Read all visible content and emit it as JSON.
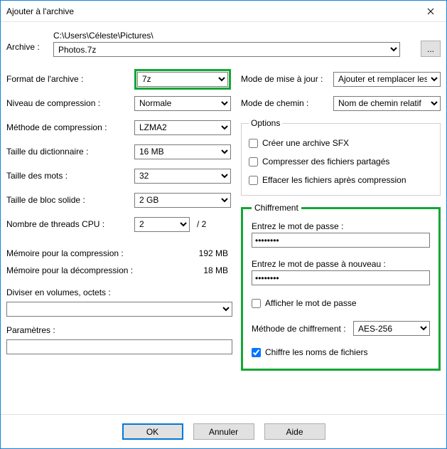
{
  "window": {
    "title": "Ajouter à l'archive"
  },
  "archive": {
    "label": "Archive :",
    "path": "C:\\Users\\Céleste\\Pictures\\",
    "file": "Photos.7z",
    "browse": "..."
  },
  "left": {
    "format_label": "Format de l'archive :",
    "format_value": "7z",
    "level_label": "Niveau de compression :",
    "level_value": "Normale",
    "method_label": "Méthode de compression :",
    "method_value": "LZMA2",
    "dict_label": "Taille du dictionnaire :",
    "dict_value": "16 MB",
    "word_label": "Taille des mots :",
    "word_value": "32",
    "block_label": "Taille de bloc solide :",
    "block_value": "2 GB",
    "threads_label": "Nombre de threads CPU :",
    "threads_value": "2",
    "threads_max": "/ 2",
    "mem_comp_label": "Mémoire pour la compression :",
    "mem_comp_value": "192 MB",
    "mem_decomp_label": "Mémoire pour la décompression :",
    "mem_decomp_value": "18 MB",
    "volumes_label": "Diviser en volumes, octets :",
    "volumes_value": "",
    "params_label": "Paramètres :",
    "params_value": ""
  },
  "right": {
    "update_label": "Mode de mise à jour :",
    "update_value": "Ajouter et remplacer les fichiers",
    "path_label": "Mode de chemin :",
    "path_value": "Nom de chemin relatif",
    "options_legend": "Options",
    "opt_sfx": "Créer une archive SFX",
    "opt_shared": "Compresser des fichiers partagés",
    "opt_delete": "Effacer les fichiers après compression"
  },
  "enc": {
    "legend": "Chiffrement",
    "pass1_label": "Entrez le mot de passe :",
    "pass1_value": "password",
    "pass2_label": "Entrez le mot de passe à nouveau :",
    "pass2_value": "password",
    "show_label": "Afficher le mot de passe",
    "method_label": "Méthode de chiffrement :",
    "method_value": "AES-256",
    "names_label": "Chiffre les noms de fichiers"
  },
  "buttons": {
    "ok": "OK",
    "cancel": "Annuler",
    "help": "Aide"
  }
}
